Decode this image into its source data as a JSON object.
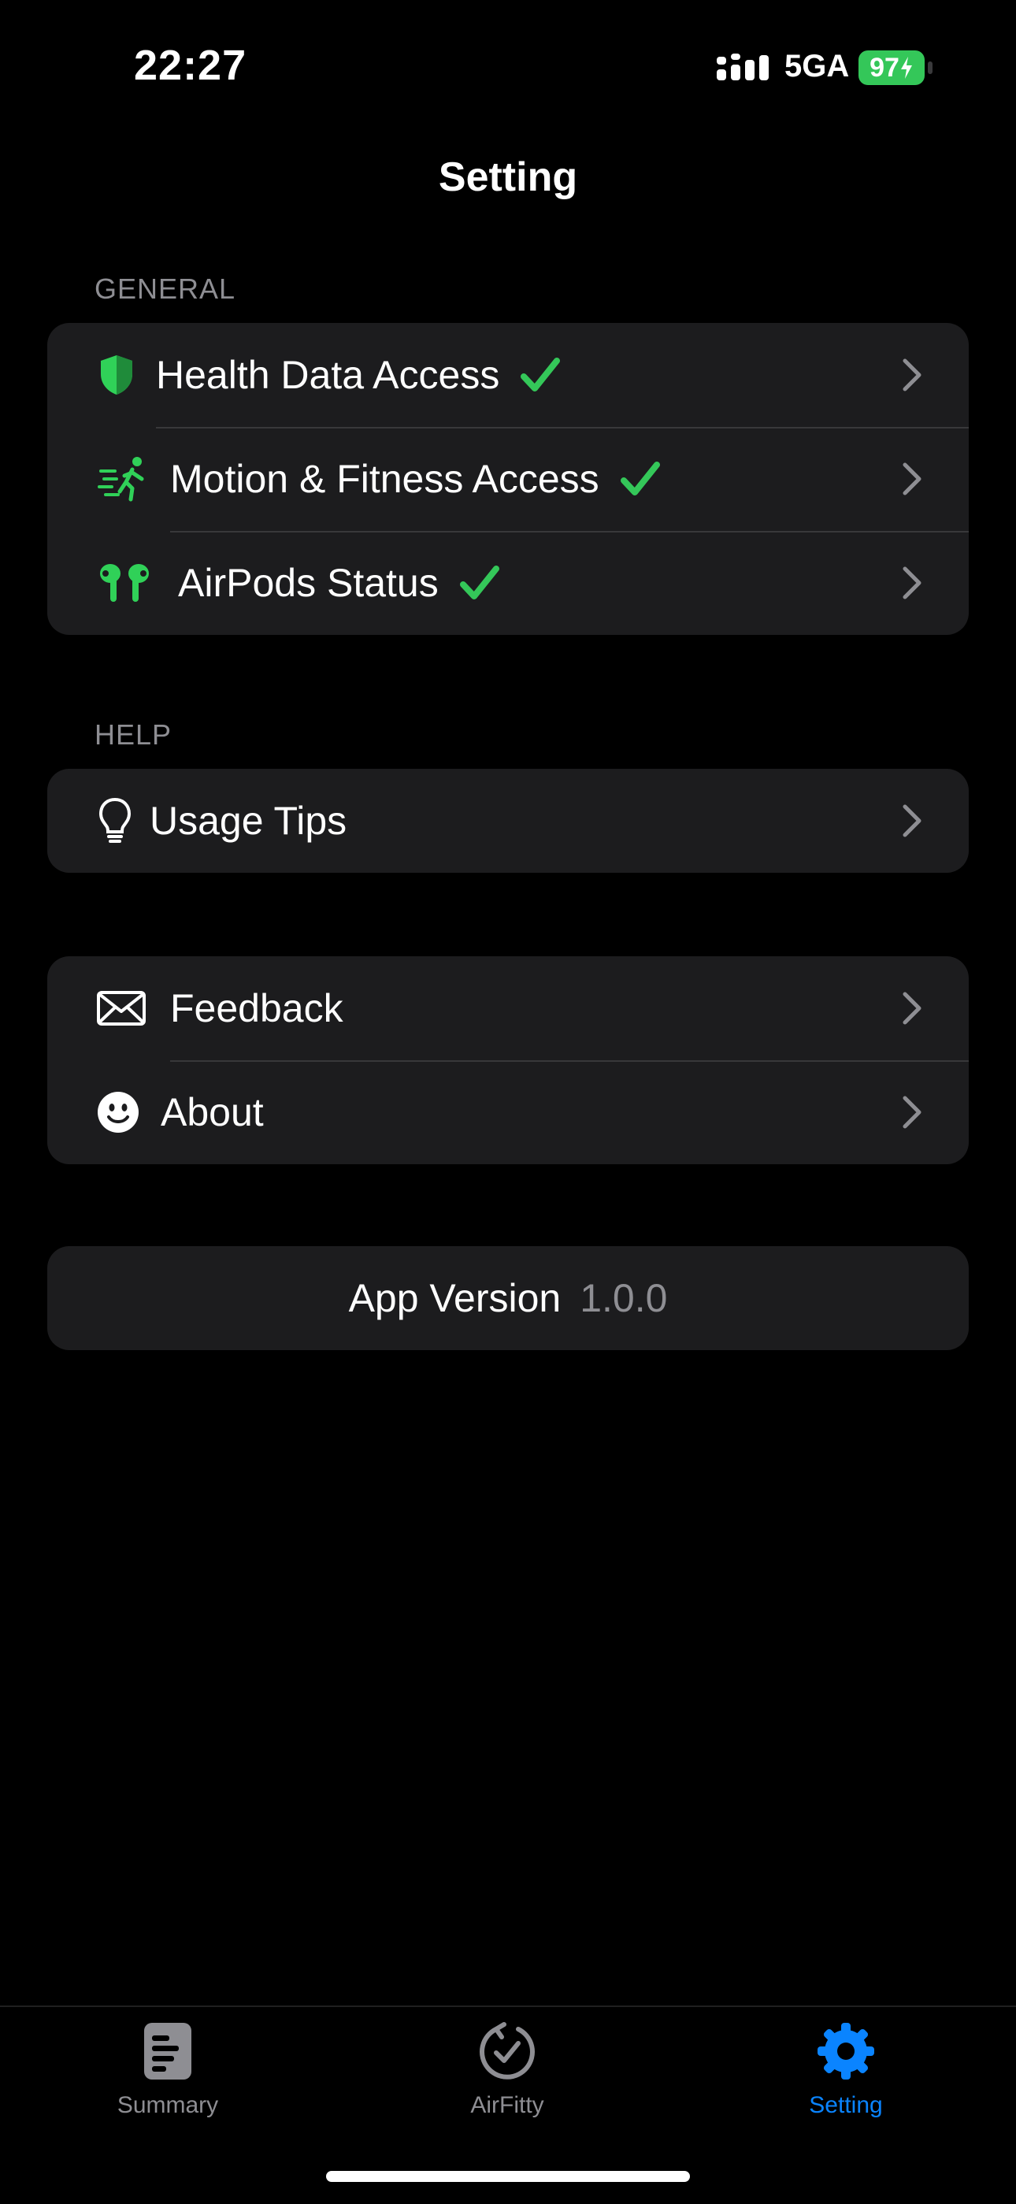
{
  "status_bar": {
    "time": "22:27",
    "network": "5GA",
    "battery": "97"
  },
  "nav": {
    "title": "Setting"
  },
  "sections": {
    "general": {
      "header": "GENERAL",
      "items": [
        {
          "label": "Health Data Access",
          "icon": "shield-icon",
          "checked": true
        },
        {
          "label": "Motion & Fitness Access",
          "icon": "running-person-icon",
          "checked": true
        },
        {
          "label": "AirPods Status",
          "icon": "airpods-icon",
          "checked": true
        }
      ]
    },
    "help": {
      "header": "HELP",
      "items": [
        {
          "label": "Usage Tips",
          "icon": "lightbulb-icon"
        }
      ]
    },
    "misc": {
      "items": [
        {
          "label": "Feedback",
          "icon": "envelope-icon"
        },
        {
          "label": "About",
          "icon": "smiley-icon"
        }
      ]
    }
  },
  "version": {
    "label": "App Version",
    "value": "1.0.0"
  },
  "tabs": [
    {
      "label": "Summary",
      "icon": "document-icon",
      "active": false
    },
    {
      "label": "AirFitty",
      "icon": "circular-check-icon",
      "active": false
    },
    {
      "label": "Setting",
      "icon": "gear-icon",
      "active": true
    }
  ],
  "colors": {
    "accent": "#0a84ff",
    "check": "#34c759",
    "icon_green": "#30d158",
    "secondary": "#8e8e93",
    "card": "#1c1c1e",
    "inactive_tab": "#8e8e93"
  }
}
